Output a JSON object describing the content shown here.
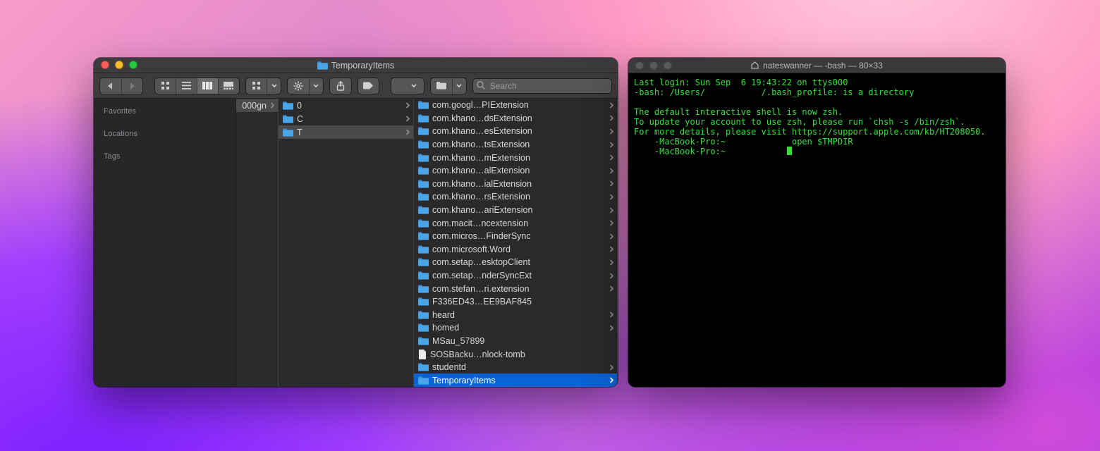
{
  "finder": {
    "title": "TemporaryItems",
    "search_placeholder": "Search",
    "sidebar": {
      "headings": [
        "Favorites",
        "Locations",
        "Tags"
      ]
    },
    "col0": {
      "label": "000gn",
      "has_children": true
    },
    "col1": [
      {
        "label": "0",
        "has_children": true,
        "selected": false
      },
      {
        "label": "C",
        "has_children": true,
        "selected": false
      },
      {
        "label": "T",
        "has_children": true,
        "selected": true
      }
    ],
    "col2": [
      {
        "label": "com.googl…PIExtension",
        "type": "folder",
        "has_children": true
      },
      {
        "label": "com.khano…dsExtension",
        "type": "folder",
        "has_children": true
      },
      {
        "label": "com.khano…esExtension",
        "type": "folder",
        "has_children": true
      },
      {
        "label": "com.khano…tsExtension",
        "type": "folder",
        "has_children": true
      },
      {
        "label": "com.khano…mExtension",
        "type": "folder",
        "has_children": true
      },
      {
        "label": "com.khano…alExtension",
        "type": "folder",
        "has_children": true
      },
      {
        "label": "com.khano…ialExtension",
        "type": "folder",
        "has_children": true
      },
      {
        "label": "com.khano…rsExtension",
        "type": "folder",
        "has_children": true
      },
      {
        "label": "com.khano…ariExtension",
        "type": "folder",
        "has_children": true
      },
      {
        "label": "com.macit…ncextension",
        "type": "folder",
        "has_children": true
      },
      {
        "label": "com.micros…FinderSync",
        "type": "folder",
        "has_children": true
      },
      {
        "label": "com.microsoft.Word",
        "type": "folder",
        "has_children": true
      },
      {
        "label": "com.setap…esktopClient",
        "type": "folder",
        "has_children": true
      },
      {
        "label": "com.setap…nderSyncExt",
        "type": "folder",
        "has_children": true
      },
      {
        "label": "com.stefan…ri.extension",
        "type": "folder",
        "has_children": true
      },
      {
        "label": "F336ED43…EE9BAF845",
        "type": "folder",
        "has_children": false
      },
      {
        "label": "heard",
        "type": "folder",
        "has_children": true
      },
      {
        "label": "homed",
        "type": "folder",
        "has_children": true
      },
      {
        "label": "MSau_57899",
        "type": "folder",
        "has_children": false
      },
      {
        "label": "SOSBacku…nlock-tomb",
        "type": "file",
        "has_children": false
      },
      {
        "label": "studentd",
        "type": "folder",
        "has_children": true
      },
      {
        "label": "TemporaryItems",
        "type": "folder",
        "has_children": true,
        "selected": true
      }
    ]
  },
  "terminal": {
    "title": "nateswanner — -bash — 80×33",
    "lines": [
      "Last login: Sun Sep  6 19:43:22 on ttys000",
      "-bash: /Users/           /.bash_profile: is a directory",
      "",
      "The default interactive shell is now zsh.",
      "To update your account to use zsh, please run `chsh -s /bin/zsh`.",
      "For more details, please visit https://support.apple.com/kb/HT208050.",
      "    -MacBook-Pro:~             open $TMPDIR",
      "    -MacBook-Pro:~            "
    ]
  }
}
